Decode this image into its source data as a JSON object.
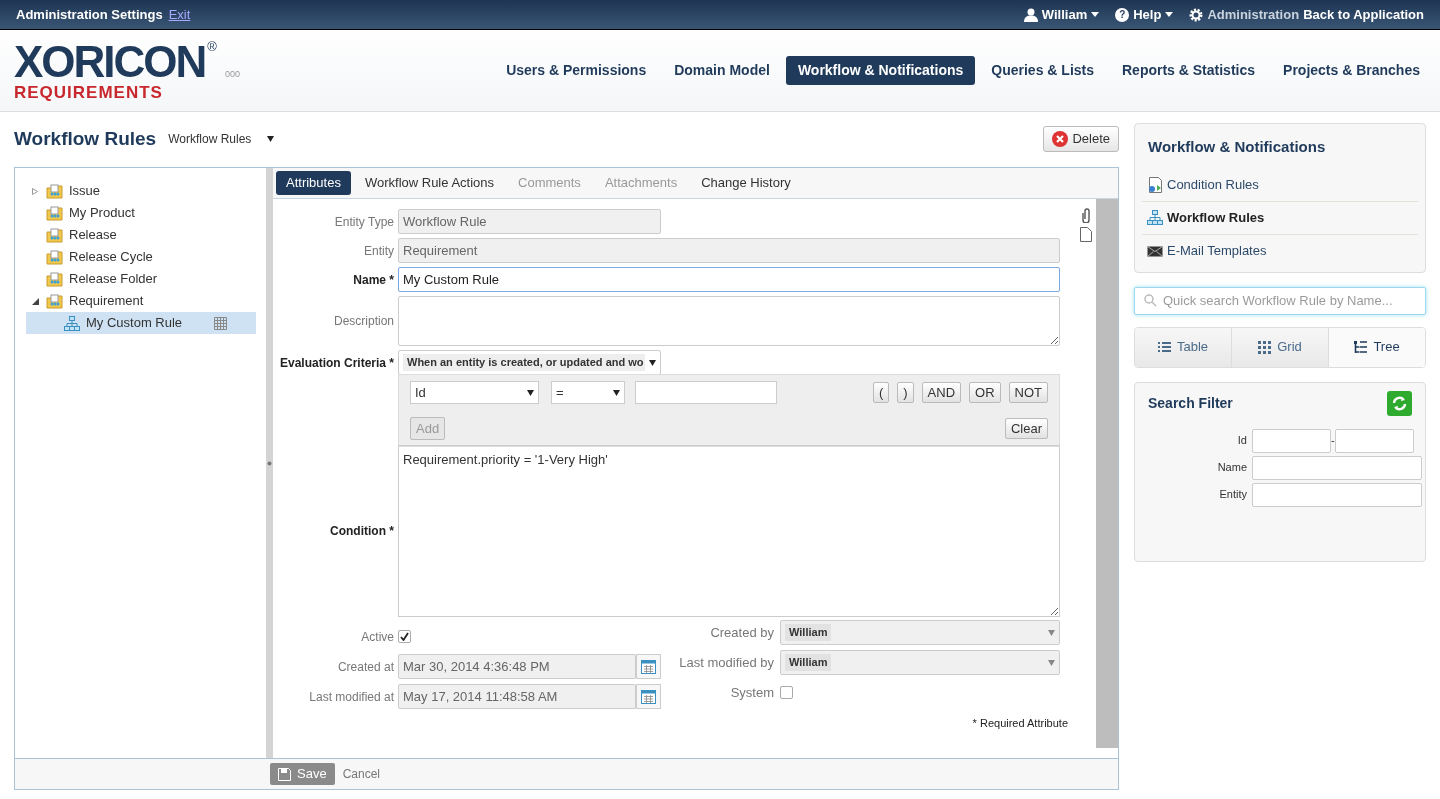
{
  "top_bar": {
    "title": "Administration Settings",
    "exit_link": "Exit",
    "user_menu": "William",
    "help_icon": "?",
    "help_menu": "Help",
    "admin_label": "Administration",
    "back_link": "Back to Application"
  },
  "logo": {
    "wordmark": "XORICON",
    "registered": "®",
    "subtitle": "REQUIREMENTS",
    "version": "000"
  },
  "nav": [
    {
      "label": "Users & Permissions",
      "selected": false
    },
    {
      "label": "Domain Model",
      "selected": false
    },
    {
      "label": "Workflow & Notifications",
      "selected": true
    },
    {
      "label": "Queries & Lists",
      "selected": false
    },
    {
      "label": "Reports & Statistics",
      "selected": false
    },
    {
      "label": "Projects & Branches",
      "selected": false
    }
  ],
  "page": {
    "title": "Workflow Rules",
    "selector": "Workflow Rules",
    "delete_button": "Delete"
  },
  "tree": [
    {
      "label": "Issue",
      "kind": "folder",
      "expanded": false,
      "selected": false
    },
    {
      "label": "My Product",
      "kind": "folder",
      "selected": false
    },
    {
      "label": "Release",
      "kind": "folder",
      "selected": false
    },
    {
      "label": "Release Cycle",
      "kind": "folder",
      "selected": false
    },
    {
      "label": "Release Folder",
      "kind": "folder",
      "selected": false
    },
    {
      "label": "Requirement",
      "kind": "folder",
      "expanded": true,
      "selected": false,
      "children": [
        {
          "label": "My Custom Rule",
          "kind": "rule",
          "selected": true
        }
      ]
    }
  ],
  "tabs": [
    {
      "label": "Attributes",
      "selected": true,
      "disabled": false
    },
    {
      "label": "Workflow Rule Actions",
      "selected": false,
      "disabled": false
    },
    {
      "label": "Comments",
      "selected": false,
      "disabled": true
    },
    {
      "label": "Attachments",
      "selected": false,
      "disabled": true
    },
    {
      "label": "Change History",
      "selected": false,
      "disabled": false
    }
  ],
  "form": {
    "entity_type": {
      "label": "Entity Type",
      "value": "Workflow Rule"
    },
    "entity": {
      "label": "Entity",
      "value": "Requirement"
    },
    "name": {
      "label": "Name *",
      "value": "My Custom Rule"
    },
    "description": {
      "label": "Description"
    },
    "evaluation_criteria": {
      "label": "Evaluation Criteria *",
      "value": "When an entity is created, or updated and wo"
    },
    "condition_builder": {
      "field": "Id",
      "operator": "=",
      "buttons": [
        "(",
        ")",
        "AND",
        "OR",
        "NOT"
      ],
      "add_button": "Add",
      "clear_button": "Clear"
    },
    "condition": {
      "label": "Condition *",
      "value": "Requirement.priority = '1-Very High'"
    },
    "active": {
      "label": "Active",
      "checked": true
    },
    "created_at": {
      "label": "Created at",
      "value": "Mar 30, 2014 4:36:48 PM"
    },
    "last_modified_at": {
      "label": "Last modified at",
      "value": "May 17, 2014 11:48:58 AM"
    },
    "created_by": {
      "label": "Created by",
      "value": "William"
    },
    "last_modified_by": {
      "label": "Last modified by",
      "value": "William"
    },
    "system": {
      "label": "System",
      "checked": false
    },
    "required_note": "* Required Attribute"
  },
  "footer": {
    "save_button": "Save",
    "cancel_link": "Cancel"
  },
  "sidebar": {
    "title": "Workflow & Notifications",
    "items": [
      {
        "label": "Condition Rules",
        "kind": "condition",
        "selected": false
      },
      {
        "label": "Workflow Rules",
        "kind": "workflow",
        "selected": true
      },
      {
        "label": "E-Mail Templates",
        "kind": "mail",
        "selected": false
      }
    ],
    "search": {
      "placeholder": "Quick search Workflow Rule by Name..."
    },
    "views": [
      {
        "label": "Table",
        "kind": "table",
        "selected": false
      },
      {
        "label": "Grid",
        "kind": "grid",
        "selected": false
      },
      {
        "label": "Tree",
        "kind": "tree",
        "selected": true
      }
    ],
    "filter": {
      "title": "Search Filter",
      "id_label": "Id",
      "range_separator": "-",
      "name_label": "Name",
      "entity_label": "Entity"
    }
  }
}
